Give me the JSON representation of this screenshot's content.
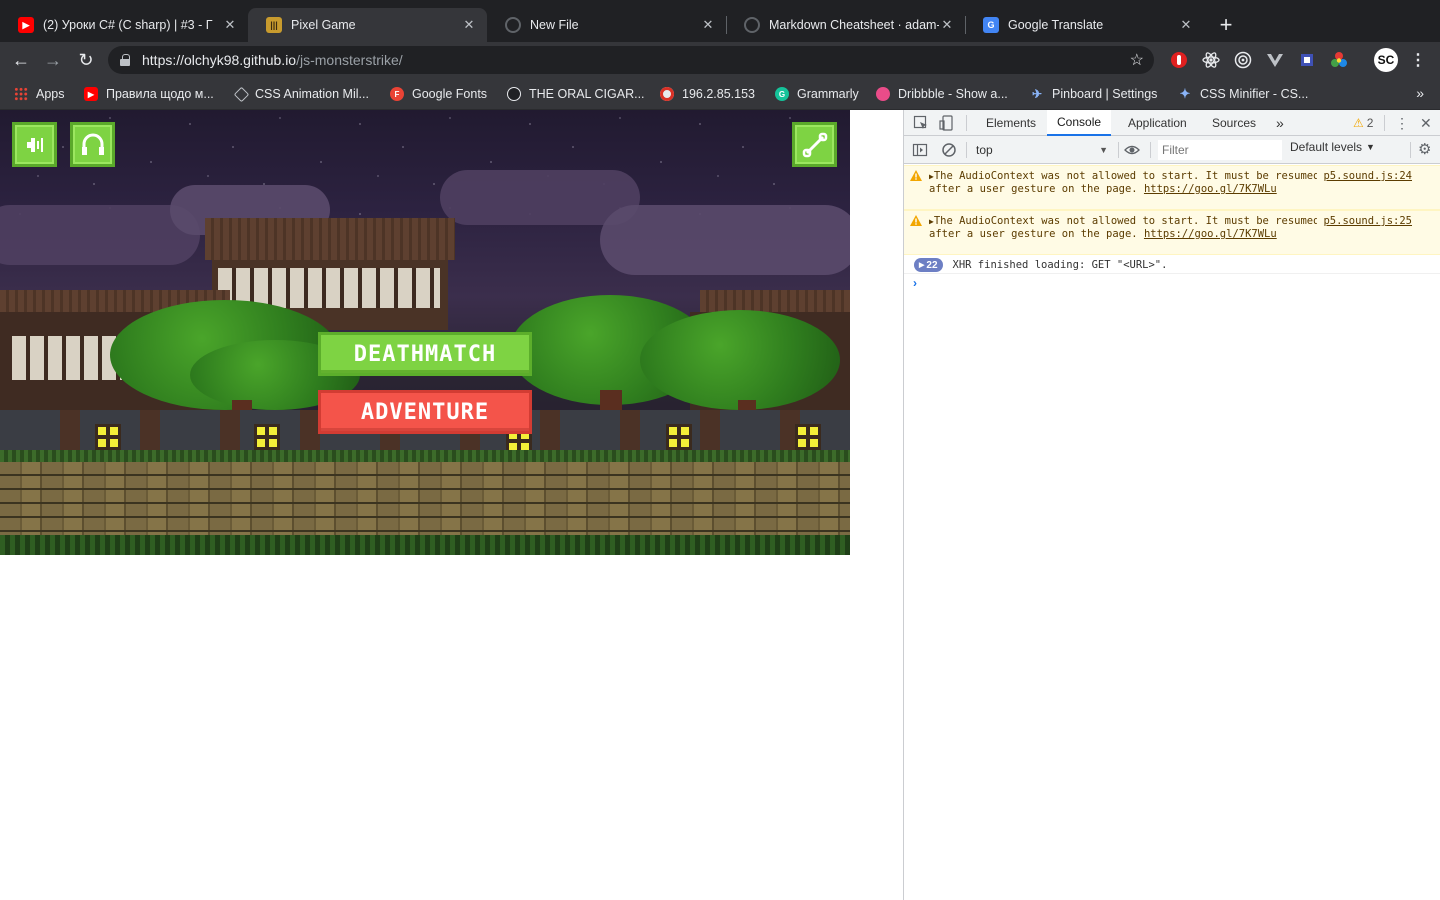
{
  "browser": {
    "tabs": [
      {
        "title": "(2) Уроки C# (C sharp) | #3 - Г",
        "favicon": "youtube-icon",
        "active": false
      },
      {
        "title": "Pixel Game",
        "favicon": "game-icon",
        "active": true
      },
      {
        "title": "New File",
        "favicon": "github-icon",
        "active": false
      },
      {
        "title": "Markdown Cheatsheet · adam-",
        "favicon": "github-icon",
        "active": false
      },
      {
        "title": "Google Translate",
        "favicon": "google-translate-icon",
        "active": false
      }
    ],
    "url_host": "https://olchyk98.github.io",
    "url_path": "/js-monsterstrike/",
    "bookmarks": [
      {
        "label": "Apps"
      },
      {
        "label": "Правила щодо м..."
      },
      {
        "label": "CSS Animation Mil..."
      },
      {
        "label": "Google Fonts"
      },
      {
        "label": "THE ORAL CIGAR..."
      },
      {
        "label": "196.2.85.153"
      },
      {
        "label": "Grammarly"
      },
      {
        "label": "Dribbble - Show a..."
      },
      {
        "label": "Pinboard | Settings"
      },
      {
        "label": "CSS Minifier - CS..."
      }
    ]
  },
  "game": {
    "deathmatch_label": "DEATHMATCH",
    "adventure_label": "ADVENTURE",
    "colors": {
      "green": "#7ed343",
      "red": "#f4544a"
    }
  },
  "devtools": {
    "tabs": [
      "Elements",
      "Console",
      "Application",
      "Sources"
    ],
    "active_tab": "Console",
    "warning_count": "2",
    "context": "top",
    "filter_placeholder": "Filter",
    "levels": "Default levels",
    "messages": [
      {
        "text": "The AudioContext was not allowed to start. It must be resumed (or created) after a user gesture on the page.",
        "link": "https://goo.gl/7K7WLu",
        "source": "p5.sound.js:24"
      },
      {
        "text": "The AudioContext was not allowed to start. It must be resumed (or created) after a user gesture on the page.",
        "link": "https://goo.gl/7K7WLu",
        "source": "p5.sound.js:25"
      }
    ],
    "xhr_count": "22",
    "xhr_text": "XHR finished loading: GET \"<URL>\"."
  }
}
